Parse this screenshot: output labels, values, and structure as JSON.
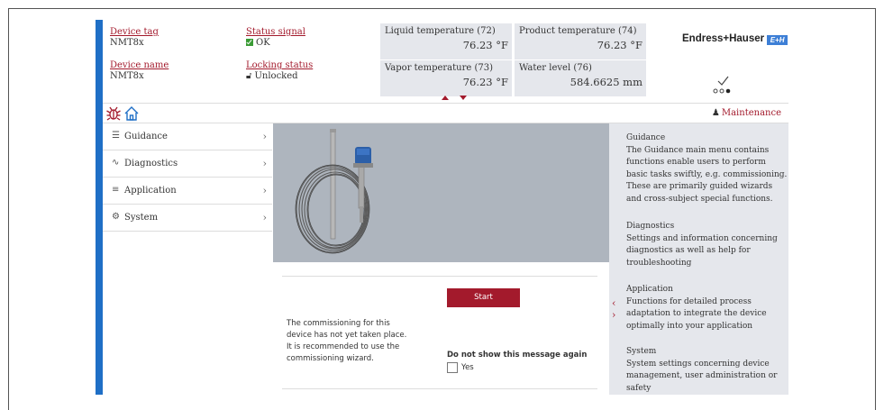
{
  "header": {
    "device_tag": {
      "label": "Device tag",
      "value": "NMT8x"
    },
    "status_signal": {
      "label": "Status signal",
      "value": "OK"
    },
    "device_name": {
      "label": "Device name",
      "value": "NMT8x"
    },
    "locking_status": {
      "label": "Locking status",
      "value": "Unlocked"
    },
    "measurements": [
      {
        "label": "Liquid temperature (72)",
        "value": "76.23 °F"
      },
      {
        "label": "Product temperature (74)",
        "value": "76.23 °F"
      },
      {
        "label": "Vapor temperature (73)",
        "value": "76.23 °F"
      },
      {
        "label": "Water level (76)",
        "value": "584.6625 mm"
      }
    ],
    "brand": "Endress+Hauser",
    "brand_logo": "E+H"
  },
  "navbar": {
    "user_role": "Maintenance"
  },
  "menu": {
    "items": [
      {
        "label": "Guidance",
        "icon": "guidance-icon"
      },
      {
        "label": "Diagnostics",
        "icon": "diagnostics-icon"
      },
      {
        "label": "Application",
        "icon": "application-icon"
      },
      {
        "label": "System",
        "icon": "system-icon"
      }
    ]
  },
  "content": {
    "message": "The commissioning for this device has not yet taken place. It is recommended to use the commissioning wizard.",
    "start_label": "Start",
    "dont_show_label": "Do not show this message again",
    "yes_label": "Yes"
  },
  "help": {
    "sections": [
      {
        "title": "Guidance",
        "text": "The Guidance main menu contains functions enable users to perform basic tasks swiftly, e.g. commissioning. These are primarily guided wizards and cross-subject special functions."
      },
      {
        "title": "Diagnostics",
        "text": "Settings and information concerning diagnostics as well as help for troubleshooting"
      },
      {
        "title": "Application",
        "text": "Functions for detailed process adaptation to integrate the device optimally into your application"
      },
      {
        "title": "System",
        "text": "System settings concerning device management, user administration or safety"
      }
    ]
  },
  "colors": {
    "accent": "#a31a2c",
    "sidebar": "#1f6fc6",
    "panel": "#e5e7ec"
  }
}
